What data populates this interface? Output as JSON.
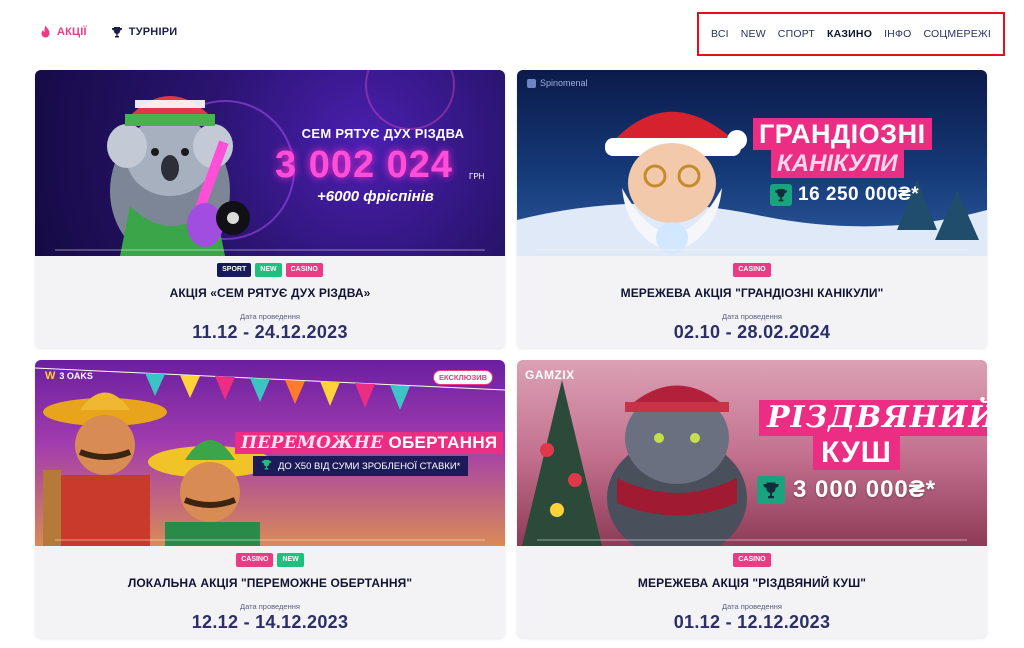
{
  "colors": {
    "accent_pink": "#ec3b83",
    "navy": "#1c1f4a",
    "tag_sport": "#141a55",
    "tag_new": "#1fbf7e",
    "tag_casino": "#ec3b83",
    "highlight_border": "#e3101b"
  },
  "nav": {
    "promotions": {
      "label": "АКЦІЇ",
      "icon": "flame-icon"
    },
    "tournaments": {
      "label": "ТУРНІРИ",
      "icon": "trophy-icon"
    }
  },
  "filters": {
    "all": "ВСІ",
    "new": "NEW",
    "sport": "СПОРТ",
    "casino": "КАЗИНО",
    "info": "ІНФО",
    "social": "СОЦМЕРЕЖІ",
    "active": "КАЗИНО"
  },
  "cards": [
    {
      "tags": [
        "SPORT",
        "NEW",
        "CASINO"
      ],
      "title": "АКЦІЯ «СЕМ РЯТУЄ ДУХ РІЗДВА»",
      "date_label": "Дата проведення",
      "date": "11.12 - 24.12.2023",
      "banner": {
        "headline": "СЕМ РЯТУЄ ДУХ РІЗДВА",
        "amount": "3 002 024",
        "currency": "ГРН",
        "freespins": "+6000 фріспінів"
      }
    },
    {
      "tags": [
        "CASINO"
      ],
      "title": "МЕРЕЖЕВА АКЦІЯ \"ГРАНДІОЗНІ КАНІКУЛИ\"",
      "date_label": "Дата проведення",
      "date": "02.10 - 28.02.2024",
      "banner": {
        "brand": "Spinomenal",
        "title_line1": "ГРАНДІОЗНІ",
        "title_line2": "КАНІКУЛИ",
        "prize": "16 250 000₴*"
      }
    },
    {
      "tags": [
        "CASINO",
        "NEW"
      ],
      "title": "ЛОКАЛЬНА АКЦІЯ \"ПЕРЕМОЖНЕ ОБЕРТАННЯ\"",
      "date_label": "Дата проведення",
      "date": "12.12 - 14.12.2023",
      "banner": {
        "brand": "3 OAKS",
        "brand_sub": "GAMING",
        "exclusive": "ЕКСКЛЮЗИВ",
        "line1_italic": "ПЕРЕМОЖНЕ",
        "line1_bold": "ОБЕРТАННЯ",
        "line2": "ДО Х50 ВІД СУМИ ЗРОБЛЕНОЇ СТАВКИ*"
      }
    },
    {
      "tags": [
        "CASINO"
      ],
      "title": "МЕРЕЖЕВА АКЦІЯ \"РІЗДВЯНИЙ КУШ\"",
      "date_label": "Дата проведення",
      "date": "01.12 - 12.12.2023",
      "banner": {
        "brand": "GAMZIX",
        "title_line1": "РІЗДВЯНИЙ",
        "title_line2": "КУШ",
        "prize": "3 000 000₴*"
      }
    }
  ]
}
